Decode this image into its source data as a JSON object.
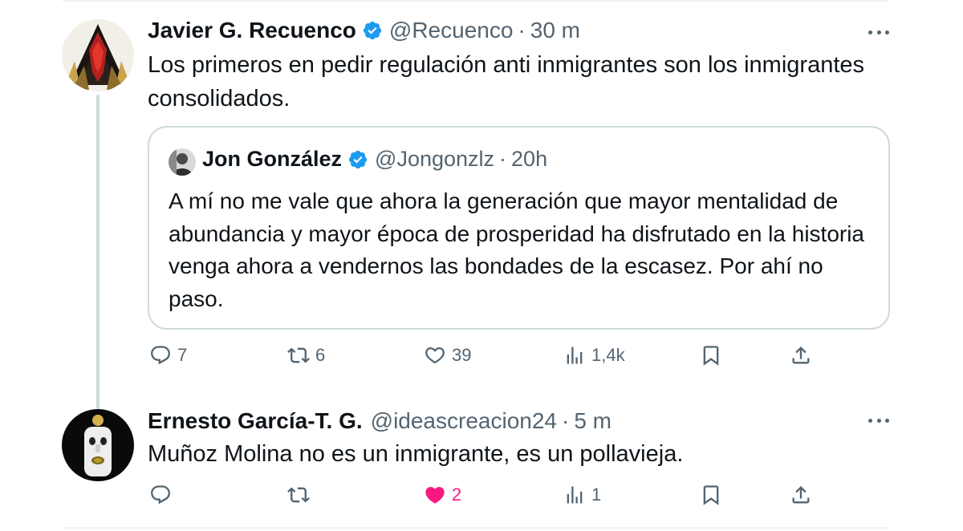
{
  "tweet1": {
    "name": "Javier G. Recuenco",
    "handle": "@Recuenco",
    "dot": "·",
    "time": "30 m",
    "text": "Los primeros en pedir regulación anti inmigrantes son los inmigrantes consolidados.",
    "quote": {
      "name": "Jon González",
      "handle": "@Jongonzlz",
      "dot": "·",
      "time": "20h",
      "text": "A mí no me vale que ahora la generación que mayor mentalidad de abundancia y mayor época de prosperidad ha disfrutado en la historia venga ahora a vendernos las bondades de la escasez. Por ahí no paso."
    },
    "actions": {
      "replies": "7",
      "reposts": "6",
      "likes": "39",
      "views": "1,4k"
    }
  },
  "tweet2": {
    "name": "Ernesto García-T. G.",
    "handle": "@ideascreacion24",
    "dot": "·",
    "time": "5 m",
    "text": "Muñoz Molina no es un inmigrante, es un pollavieja.",
    "actions": {
      "replies": "",
      "reposts": "",
      "likes": "2",
      "views": "1"
    }
  },
  "colors": {
    "text": "#0f1419",
    "secondary": "#536471",
    "verified": "#1d9bf0",
    "like": "#f91880",
    "border": "#cfd9de"
  },
  "icons": [
    "verified-badge-icon",
    "more-icon",
    "reply-icon",
    "repost-icon",
    "like-icon",
    "views-icon",
    "bookmark-icon",
    "share-icon"
  ]
}
